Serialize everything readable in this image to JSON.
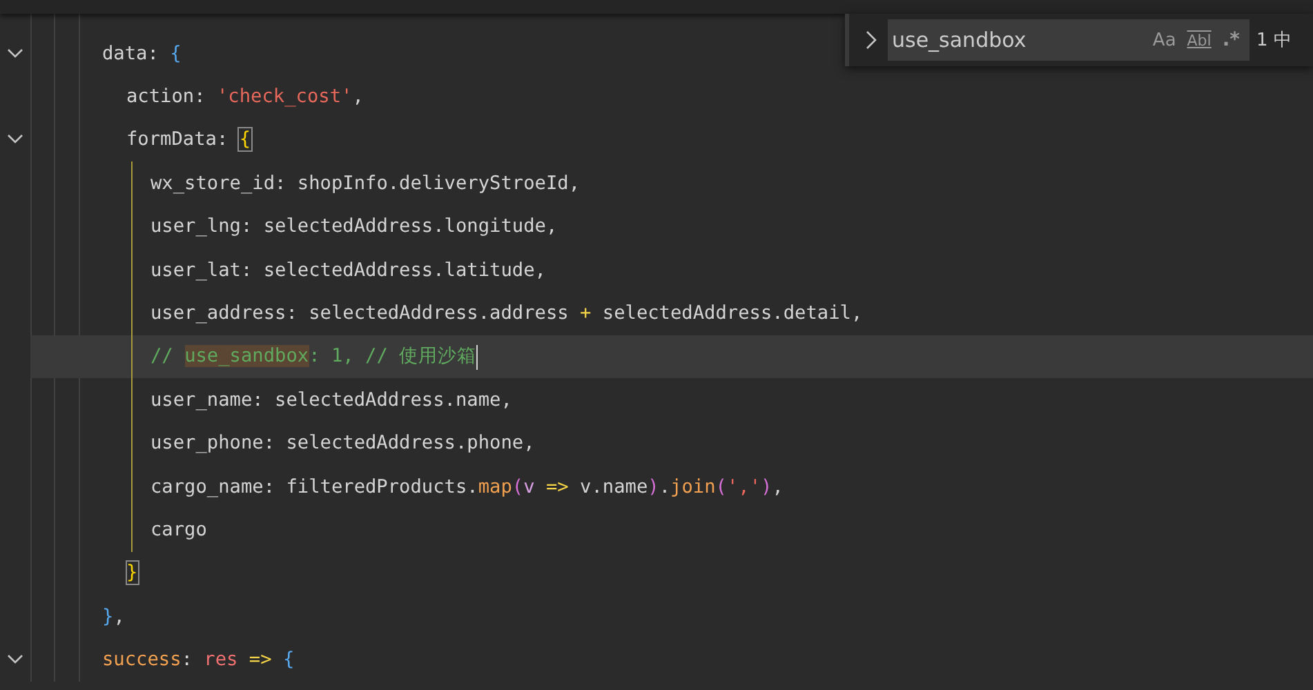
{
  "find_widget": {
    "value": "use_sandbox",
    "options": [
      {
        "kind": "match-case",
        "label": "Aa"
      },
      {
        "kind": "whole-word",
        "label": "Abl"
      },
      {
        "kind": "regex",
        "label": ".*"
      }
    ],
    "result": "1 中"
  },
  "lines": [
    {
      "foldable": true,
      "tokens": [
        {
          "kind": "key",
          "text": "data"
        },
        {
          "kind": "punct",
          "text": ": "
        },
        {
          "kind": "brace",
          "text": "{"
        }
      ],
      "children": [
        {
          "tokens": [
            {
              "kind": "key",
              "text": "action"
            },
            {
              "kind": "punct",
              "text": ": "
            },
            {
              "kind": "string",
              "text": "'check_cost'"
            },
            {
              "kind": "punct",
              "text": ","
            }
          ]
        },
        {
          "foldable": true,
          "scope_active": true,
          "tokens": [
            {
              "kind": "key",
              "text": "formData"
            },
            {
              "kind": "punct",
              "text": ": "
            },
            {
              "kind": "bracket-match",
              "text": "{"
            }
          ],
          "children": [
            {
              "tokens": [
                {
                  "kind": "key",
                  "text": "wx_store_id"
                },
                {
                  "kind": "punct",
                  "text": ": shopInfo.deliveryStroeId,"
                }
              ]
            },
            {
              "tokens": [
                {
                  "kind": "key",
                  "text": "user_lng"
                },
                {
                  "kind": "punct",
                  "text": ": selectedAddress.longitude,"
                }
              ]
            },
            {
              "tokens": [
                {
                  "kind": "key",
                  "text": "user_lat"
                },
                {
                  "kind": "punct",
                  "text": ": selectedAddress.latitude,"
                }
              ]
            },
            {
              "tokens": [
                {
                  "kind": "key",
                  "text": "user_address"
                },
                {
                  "kind": "punct",
                  "text": ": selectedAddress.address "
                },
                {
                  "kind": "operator",
                  "text": "+"
                },
                {
                  "kind": "punct",
                  "text": " selectedAddress.detail,"
                }
              ]
            },
            {
              "current": true,
              "tokens": [
                {
                  "kind": "comment",
                  "text": "// "
                },
                {
                  "kind": "comment-match",
                  "text": "use_sandbox"
                },
                {
                  "kind": "comment",
                  "text": ": 1, // 使用沙箱"
                }
              ]
            },
            {
              "tokens": [
                {
                  "kind": "key",
                  "text": "user_name"
                },
                {
                  "kind": "punct",
                  "text": ": selectedAddress.name,"
                }
              ]
            },
            {
              "tokens": [
                {
                  "kind": "key",
                  "text": "user_phone"
                },
                {
                  "kind": "punct",
                  "text": ": selectedAddress.phone,"
                }
              ]
            },
            {
              "tokens": [
                {
                  "kind": "key",
                  "text": "cargo_name"
                },
                {
                  "kind": "punct",
                  "text": ": filteredProducts."
                },
                {
                  "kind": "function",
                  "text": "map"
                },
                {
                  "kind": "paren",
                  "text": "("
                },
                {
                  "kind": "param",
                  "text": "v"
                },
                {
                  "kind": "operator",
                  "text": " => "
                },
                {
                  "kind": "punct",
                  "text": "v.name"
                },
                {
                  "kind": "paren",
                  "text": ")"
                },
                {
                  "kind": "punct",
                  "text": "."
                },
                {
                  "kind": "function",
                  "text": "join"
                },
                {
                  "kind": "paren",
                  "text": "("
                },
                {
                  "kind": "string",
                  "text": "','"
                },
                {
                  "kind": "paren",
                  "text": ")"
                },
                {
                  "kind": "punct",
                  "text": ","
                }
              ]
            },
            {
              "tokens": [
                {
                  "kind": "plain",
                  "text": "cargo"
                }
              ]
            }
          ]
        },
        {
          "tokens": [
            {
              "kind": "bracket-match",
              "text": "}"
            }
          ]
        }
      ]
    },
    {
      "tokens": [
        {
          "kind": "brace",
          "text": "}"
        },
        {
          "kind": "punct",
          "text": ","
        }
      ]
    },
    {
      "foldable": true,
      "tokens": [
        {
          "kind": "function",
          "text": "success"
        },
        {
          "kind": "punct",
          "text": ": "
        },
        {
          "kind": "variable",
          "text": "res"
        },
        {
          "kind": "operator",
          "text": " => "
        },
        {
          "kind": "brace",
          "text": "{"
        }
      ]
    }
  ]
}
